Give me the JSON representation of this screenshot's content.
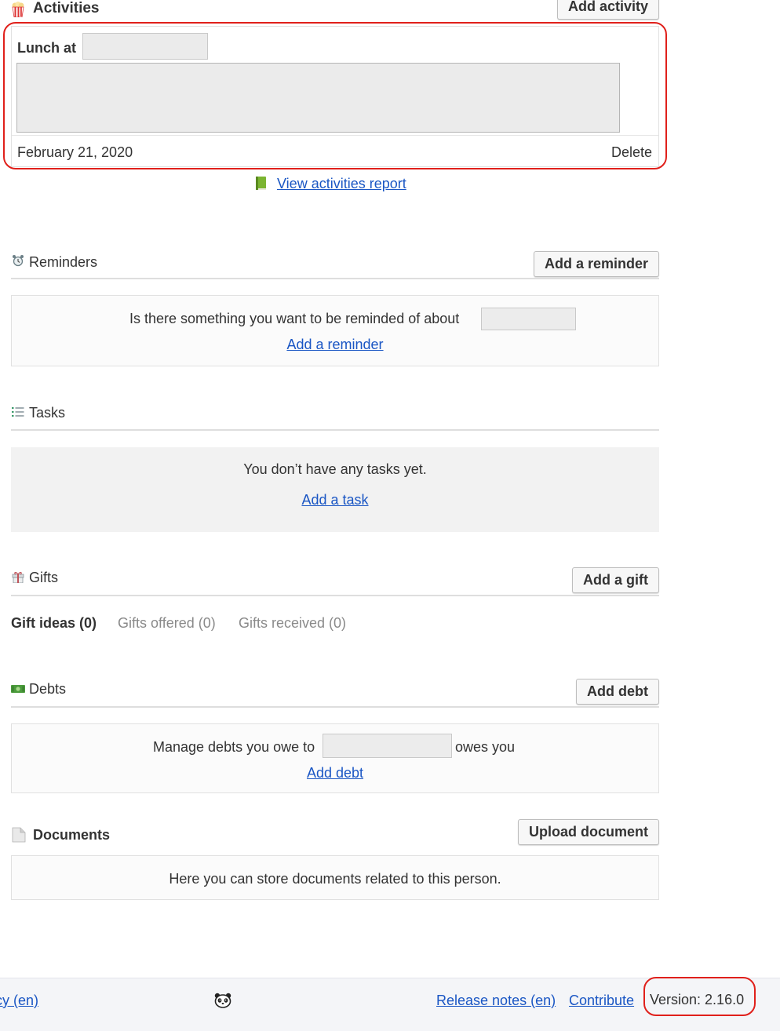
{
  "activities": {
    "section_title": "Activities",
    "add_button": "Add activity",
    "entry": {
      "title_prefix": "Lunch at",
      "date": "February 21, 2020",
      "delete_label": "Delete"
    },
    "report_link": "View activities report"
  },
  "reminders": {
    "section_title": "Reminders",
    "add_button": "Add a reminder",
    "prompt": "Is there something you want to be reminded of about",
    "add_link": "Add a reminder"
  },
  "tasks": {
    "section_title": "Tasks",
    "empty_text": "You don’t have any tasks yet.",
    "add_link": "Add a task"
  },
  "gifts": {
    "section_title": "Gifts",
    "add_button": "Add a gift",
    "tabs": [
      {
        "label": "Gift ideas (0)",
        "active": true
      },
      {
        "label": "Gifts offered (0)",
        "active": false
      },
      {
        "label": "Gifts received (0)",
        "active": false
      }
    ]
  },
  "debts": {
    "section_title": "Debts",
    "add_button": "Add debt",
    "prompt_before": "Manage debts you owe to",
    "prompt_after": "owes you",
    "add_link": "Add debt"
  },
  "documents": {
    "section_title": "Documents",
    "upload_button": "Upload document",
    "empty_text": "Here you can store documents related to this person."
  },
  "footer": {
    "privacy_link_partial": "cy (en)",
    "release_notes_link": "Release notes (en)",
    "contribute_link": "Contribute",
    "version_text": "Version: 2.16.0"
  },
  "colors": {
    "link": "#1a56c4",
    "highlight_annotation": "#e0201b",
    "footer_bg": "#f4f5f8"
  }
}
